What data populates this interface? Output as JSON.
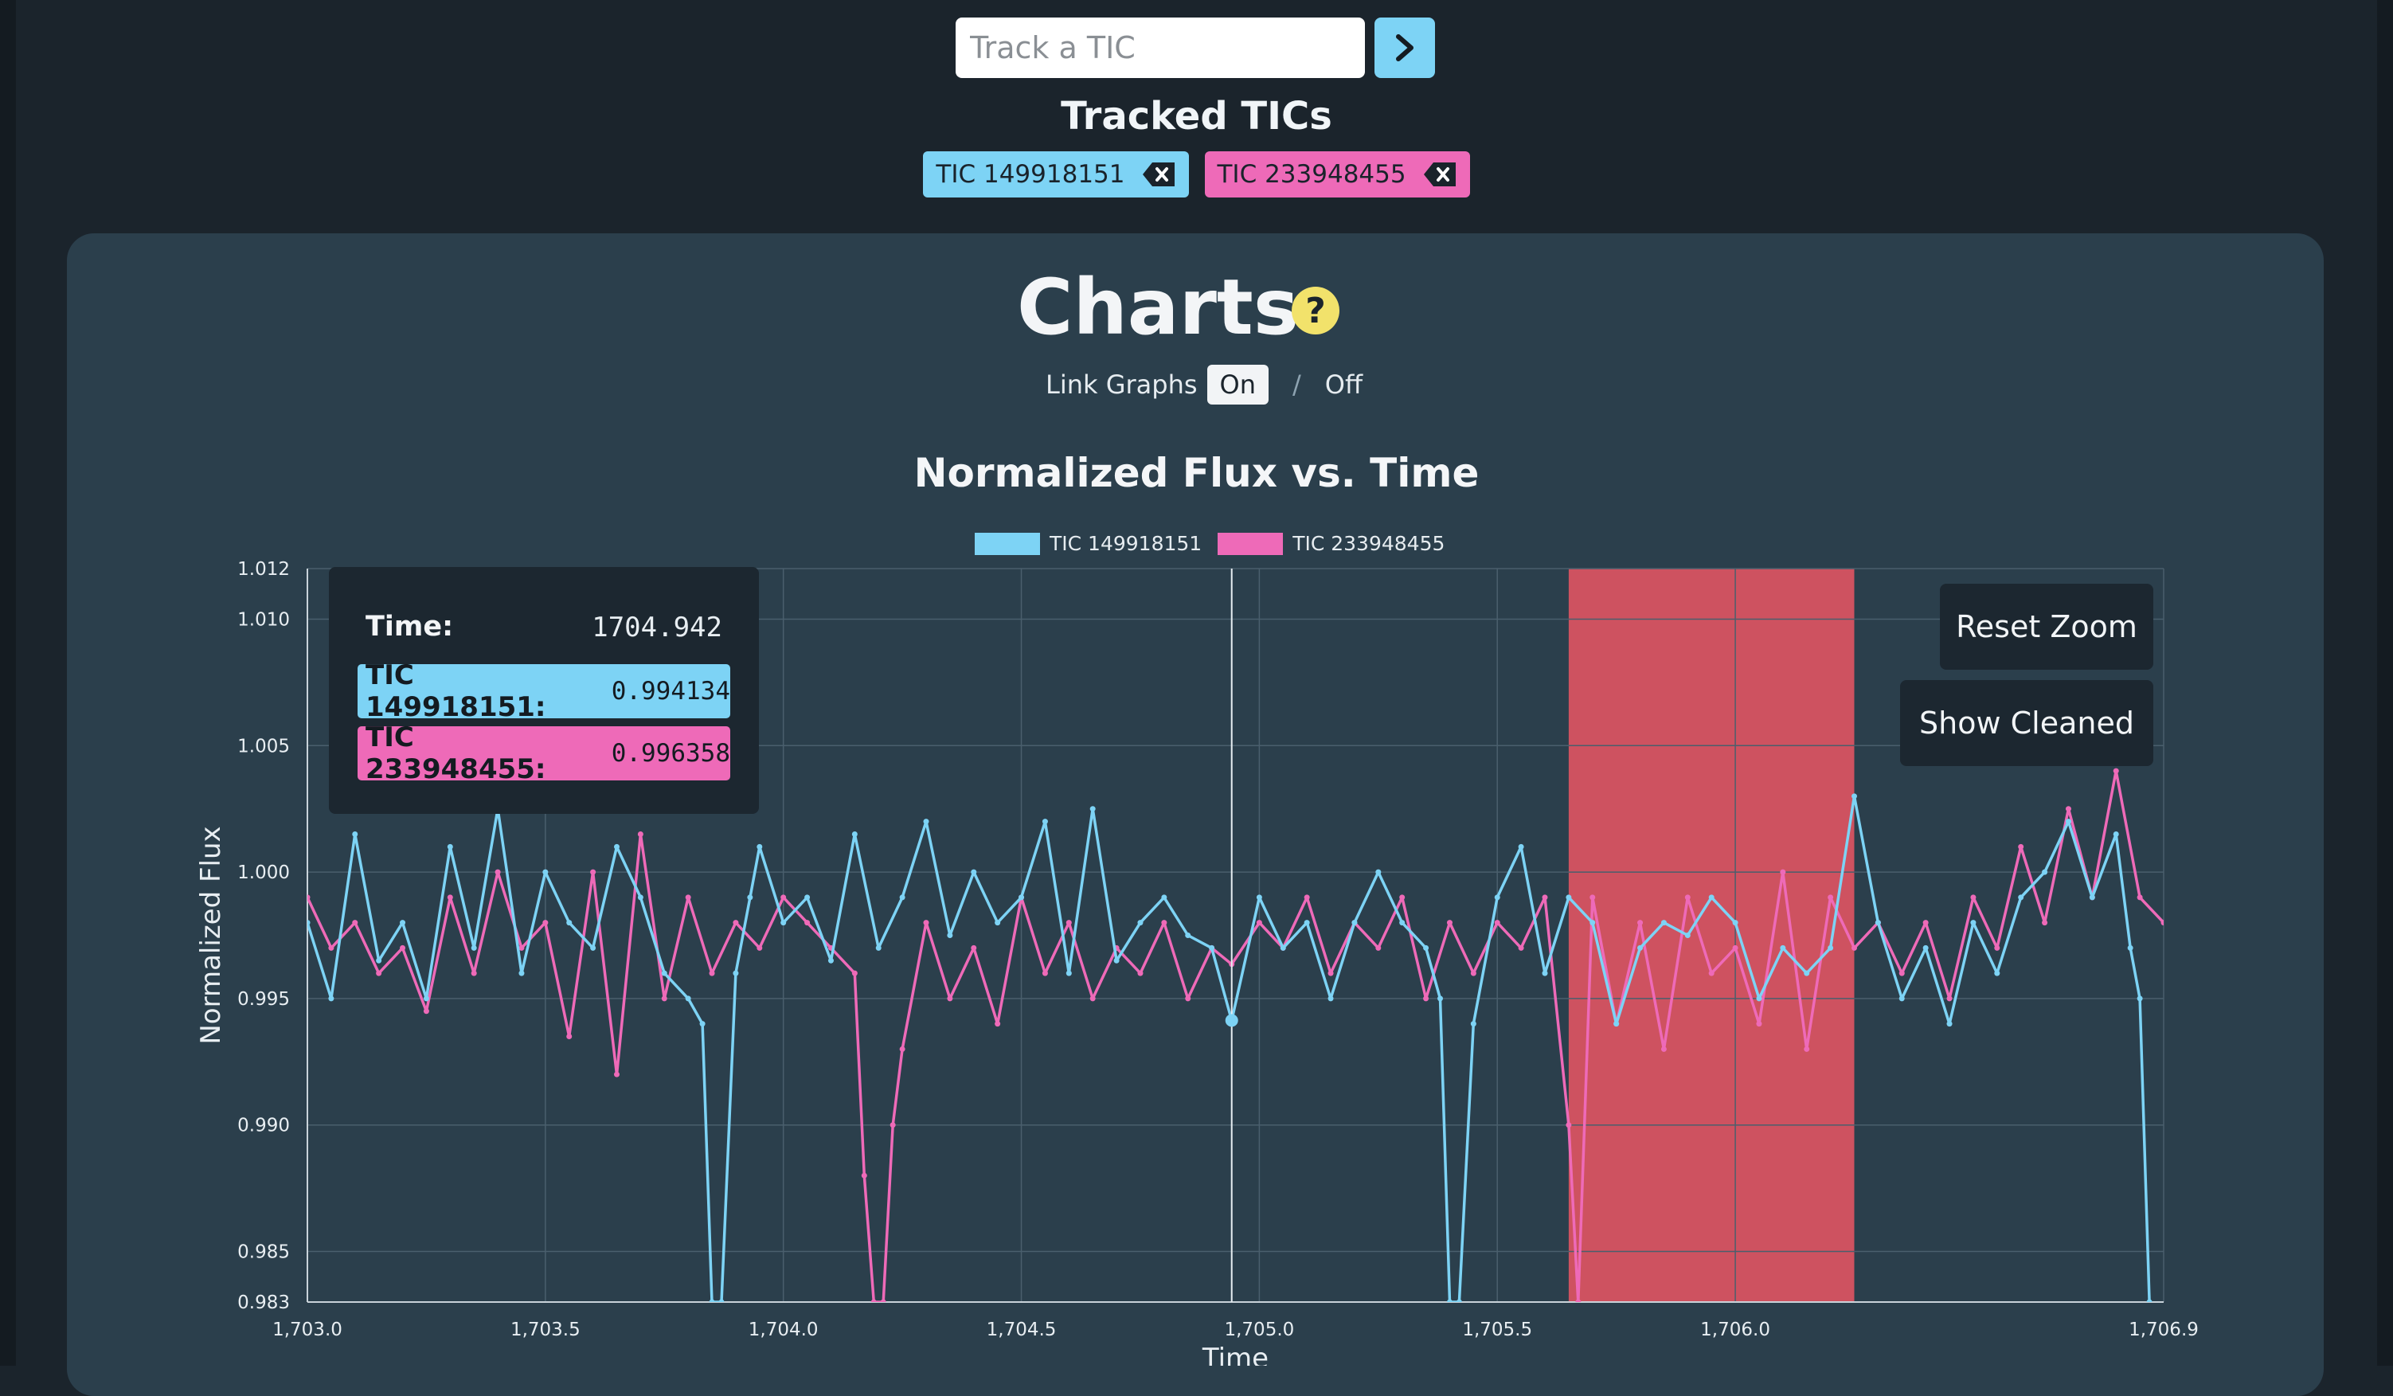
{
  "track": {
    "placeholder": "Track a TIC"
  },
  "tracked": {
    "title": "Tracked TICs",
    "chips": [
      {
        "label": "TIC 149918151",
        "color": "#7dd3f5"
      },
      {
        "label": "TIC 233948455",
        "color": "#ee6ab8"
      }
    ]
  },
  "charts": {
    "title": "Charts",
    "help_symbol": "?",
    "link_label": "Link Graphs",
    "link_on": "On",
    "link_sep": "/",
    "link_off": "Off"
  },
  "controls": {
    "reset_zoom": "Reset Zoom",
    "show_cleaned": "Show Cleaned"
  },
  "tooltip": {
    "time_label": "Time:",
    "time_value": "1704.942",
    "rows": [
      {
        "name": "TIC 149918151:",
        "value": "0.994134"
      },
      {
        "name": "TIC 233948455:",
        "value": "0.996358"
      }
    ]
  },
  "colors": {
    "series1": "#7dd3f5",
    "series2": "#ee6ab8",
    "highlight": "#dc5462",
    "panel": "#2b3f4c"
  },
  "chart_data": {
    "type": "line",
    "title": "Normalized Flux vs. Time",
    "xlabel": "Time",
    "ylabel": "Normalized Flux",
    "xlim": [
      1703.0,
      1706.9
    ],
    "ylim": [
      0.983,
      1.012
    ],
    "x_ticks": [
      1703.0,
      1703.5,
      1704.0,
      1704.5,
      1705.0,
      1705.5,
      1706.0,
      1706.9
    ],
    "x_tick_labels": [
      "1,703.0",
      "1,703.5",
      "1,704.0",
      "1,704.5",
      "1,705.0",
      "1,705.5",
      "1,706.0",
      "1,706.9"
    ],
    "y_ticks": [
      0.983,
      0.985,
      0.99,
      0.995,
      1.0,
      1.005,
      1.01,
      1.012
    ],
    "y_tick_labels": [
      "0.983",
      "0.985",
      "0.990",
      "0.995",
      "1.000",
      "1.005",
      "1.010",
      "1.012"
    ],
    "grid": true,
    "legend_position": "top-center",
    "highlight_range": [
      1705.65,
      1706.25
    ],
    "crosshair_x": 1704.942,
    "series": [
      {
        "name": "TIC 149918151",
        "color": "#7dd3f5",
        "x": [
          1703.0,
          1703.05,
          1703.1,
          1703.15,
          1703.2,
          1703.25,
          1703.3,
          1703.35,
          1703.4,
          1703.45,
          1703.5,
          1703.55,
          1703.6,
          1703.65,
          1703.7,
          1703.75,
          1703.8,
          1703.83,
          1703.85,
          1703.87,
          1703.9,
          1703.93,
          1703.95,
          1704.0,
          1704.05,
          1704.1,
          1704.15,
          1704.2,
          1704.25,
          1704.3,
          1704.35,
          1704.4,
          1704.45,
          1704.5,
          1704.55,
          1704.6,
          1704.65,
          1704.7,
          1704.75,
          1704.8,
          1704.85,
          1704.9,
          1704.942,
          1705.0,
          1705.05,
          1705.1,
          1705.15,
          1705.2,
          1705.25,
          1705.3,
          1705.35,
          1705.38,
          1705.4,
          1705.42,
          1705.45,
          1705.5,
          1705.55,
          1705.6,
          1705.65,
          1705.7,
          1705.75,
          1705.8,
          1705.85,
          1705.9,
          1705.95,
          1706.0,
          1706.05,
          1706.1,
          1706.15,
          1706.2,
          1706.25,
          1706.3,
          1706.35,
          1706.4,
          1706.45,
          1706.5,
          1706.55,
          1706.6,
          1706.65,
          1706.7,
          1706.75,
          1706.8,
          1706.83,
          1706.85,
          1706.87
        ],
        "y": [
          0.998,
          0.995,
          1.0015,
          0.9965,
          0.998,
          0.995,
          1.001,
          0.997,
          1.0025,
          0.996,
          1.0,
          0.998,
          0.997,
          1.001,
          0.999,
          0.996,
          0.995,
          0.994,
          0.983,
          0.983,
          0.996,
          0.999,
          1.001,
          0.998,
          0.999,
          0.9965,
          1.0015,
          0.997,
          0.999,
          1.002,
          0.9975,
          1.0,
          0.998,
          0.999,
          1.002,
          0.996,
          1.0025,
          0.9965,
          0.998,
          0.999,
          0.9975,
          0.997,
          0.994134,
          0.999,
          0.997,
          0.998,
          0.995,
          0.998,
          1.0,
          0.998,
          0.997,
          0.995,
          0.983,
          0.983,
          0.994,
          0.999,
          1.001,
          0.996,
          0.999,
          0.998,
          0.994,
          0.997,
          0.998,
          0.9975,
          0.999,
          0.998,
          0.995,
          0.997,
          0.996,
          0.997,
          1.003,
          0.998,
          0.995,
          0.997,
          0.994,
          0.998,
          0.996,
          0.999,
          1.0,
          1.002,
          0.999,
          1.0015,
          0.997,
          0.995,
          0.983
        ]
      },
      {
        "name": "TIC 233948455",
        "color": "#ee6ab8",
        "x": [
          1703.0,
          1703.05,
          1703.1,
          1703.15,
          1703.2,
          1703.25,
          1703.3,
          1703.35,
          1703.4,
          1703.45,
          1703.5,
          1703.55,
          1703.6,
          1703.65,
          1703.7,
          1703.75,
          1703.8,
          1703.85,
          1703.9,
          1703.95,
          1704.0,
          1704.05,
          1704.1,
          1704.15,
          1704.17,
          1704.19,
          1704.21,
          1704.23,
          1704.25,
          1704.3,
          1704.35,
          1704.4,
          1704.45,
          1704.5,
          1704.55,
          1704.6,
          1704.65,
          1704.7,
          1704.75,
          1704.8,
          1704.85,
          1704.9,
          1704.942,
          1705.0,
          1705.05,
          1705.1,
          1705.15,
          1705.2,
          1705.25,
          1705.3,
          1705.35,
          1705.4,
          1705.45,
          1705.5,
          1705.55,
          1705.6,
          1705.65,
          1705.67,
          1705.7,
          1705.75,
          1705.8,
          1705.85,
          1705.9,
          1705.95,
          1706.0,
          1706.05,
          1706.1,
          1706.15,
          1706.2,
          1706.25,
          1706.3,
          1706.35,
          1706.4,
          1706.45,
          1706.5,
          1706.55,
          1706.6,
          1706.65,
          1706.7,
          1706.75,
          1706.8,
          1706.85,
          1706.9
        ],
        "y": [
          0.999,
          0.997,
          0.998,
          0.996,
          0.997,
          0.9945,
          0.999,
          0.996,
          1.0,
          0.997,
          0.998,
          0.9935,
          1.0,
          0.992,
          1.0015,
          0.995,
          0.999,
          0.996,
          0.998,
          0.997,
          0.999,
          0.998,
          0.997,
          0.996,
          0.988,
          0.983,
          0.983,
          0.99,
          0.993,
          0.998,
          0.995,
          0.997,
          0.994,
          0.999,
          0.996,
          0.998,
          0.995,
          0.997,
          0.996,
          0.998,
          0.995,
          0.997,
          0.996358,
          0.998,
          0.997,
          0.999,
          0.996,
          0.998,
          0.997,
          0.999,
          0.995,
          0.998,
          0.996,
          0.998,
          0.997,
          0.999,
          0.99,
          0.983,
          0.999,
          0.994,
          0.998,
          0.993,
          0.999,
          0.996,
          0.997,
          0.994,
          1.0,
          0.993,
          0.999,
          0.997,
          0.998,
          0.996,
          0.998,
          0.995,
          0.999,
          0.997,
          1.001,
          0.998,
          1.0025,
          0.999,
          1.004,
          0.999,
          0.998
        ]
      }
    ]
  }
}
